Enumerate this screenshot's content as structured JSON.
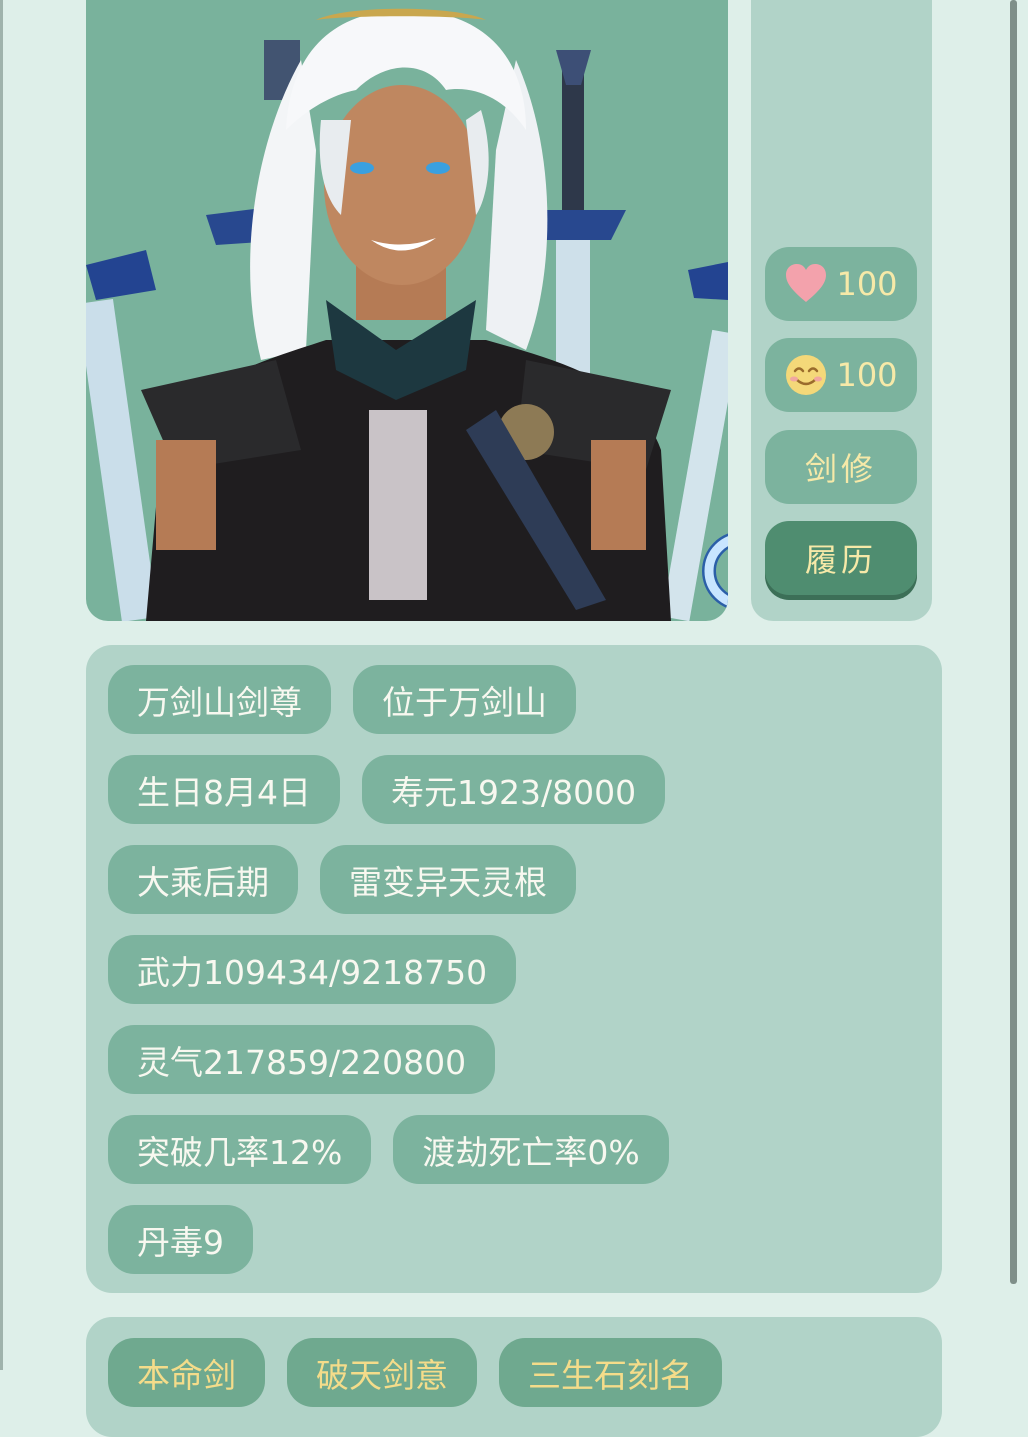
{
  "character": {
    "stats": {
      "affection": "100",
      "mood": "100",
      "class": "剑修",
      "resume_button": "履历"
    },
    "info_rows": [
      [
        "万剑山剑尊",
        "位于万剑山"
      ],
      [
        "生日8月4日",
        "寿元1923/8000"
      ],
      [
        "大乘后期",
        "雷变异天灵根"
      ],
      [
        "武力109434/9218750"
      ],
      [
        "灵气217859/220800"
      ],
      [
        "突破几率12%",
        "渡劫死亡率0%"
      ],
      [
        "丹毒9"
      ]
    ],
    "skill_tags": [
      "本命剑",
      "破天剑意",
      "三生石刻名"
    ]
  },
  "icons": {
    "affection": "heart-icon",
    "mood": "smile-face-icon",
    "gender": "male-symbol-icon"
  },
  "colors": {
    "page_bg": "#deefe9",
    "panel_bg": "#b1d3c8",
    "pill_bg": "#7cb39e",
    "button_active": "#4f8d70",
    "stat_text": "#f6e9a8",
    "heart": "#f3a2ac",
    "gender_icon": "#b9dcfb"
  }
}
